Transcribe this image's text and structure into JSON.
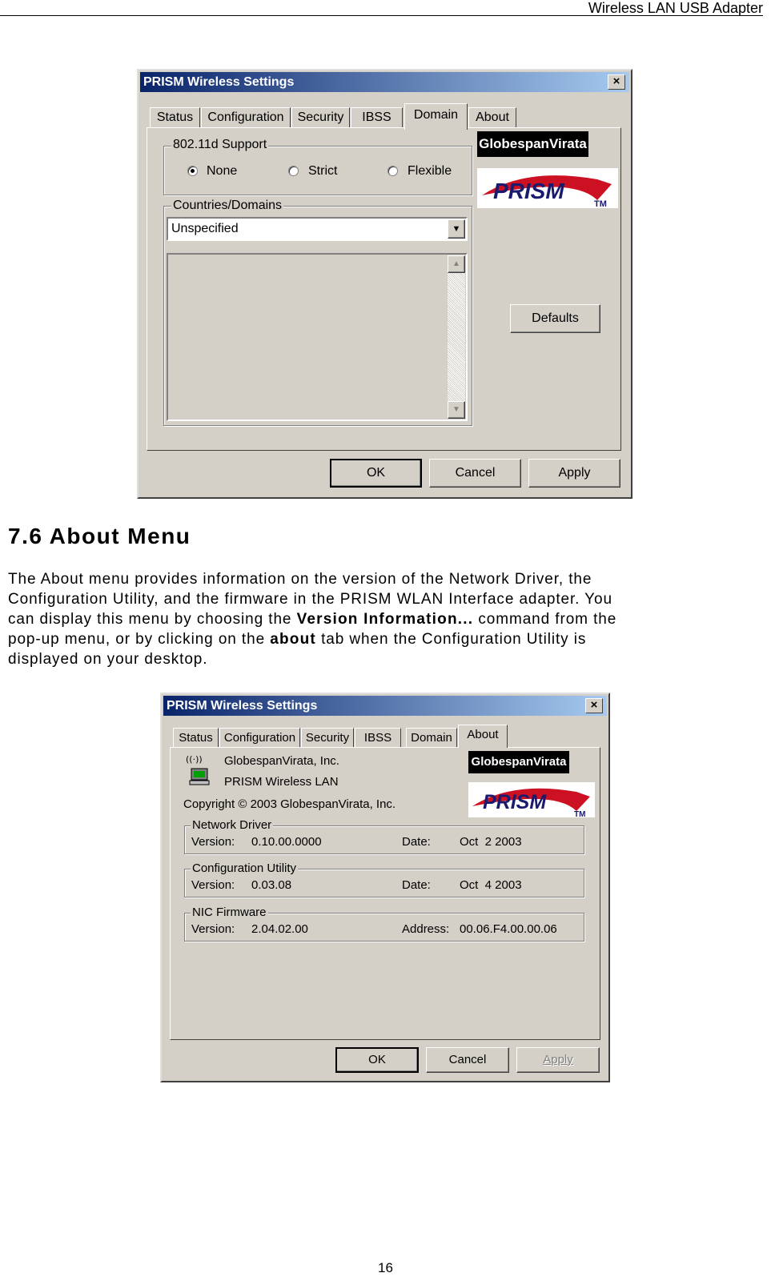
{
  "header": {
    "title": "Wireless LAN USB Adapter"
  },
  "page_number": "16",
  "section": {
    "heading": "7.6 About Menu",
    "para_1": "The About menu provides information on the version of the Network Driver, the",
    "para_2": "Configuration Utility, and the firmware in the PRISM WLAN Interface adapter. You",
    "para_3a": "can display this menu by choosing the ",
    "para_3b": "Version Information...",
    "para_3c": " command from the",
    "para_4a": "pop-up menu, or by clicking on the ",
    "para_4b": "about",
    "para_4c": " tab when the Configuration Utility is",
    "para_5": "displayed on your desktop."
  },
  "dialog1": {
    "title": "PRISM Wireless Settings",
    "close": "×",
    "tabs": [
      "Status",
      "Configuration",
      "Security",
      "IBSS",
      "Domain",
      "About"
    ],
    "active_tab": "Domain",
    "support_group": "802.11d Support",
    "radios": [
      "None",
      "Strict",
      "Flexible"
    ],
    "selected_radio": "None",
    "countries_group": "Countries/Domains",
    "dropdown_value": "Unspecified",
    "defaults_button": "Defaults",
    "logo_gv": "GlobespanVirata",
    "logo_prism": "PRISM",
    "logo_tm": "TM",
    "ok": "OK",
    "cancel": "Cancel",
    "apply": "Apply"
  },
  "dialog2": {
    "title": "PRISM Wireless Settings",
    "close": "×",
    "tabs": [
      "Status",
      "Configuration",
      "Security",
      "IBSS",
      "Domain",
      "About"
    ],
    "active_tab": "About",
    "company": "GlobespanVirata, Inc.",
    "product": "PRISM Wireless LAN",
    "copyright": "Copyright © 2003  GlobespanVirata, Inc.",
    "logo_gv": "GlobespanVirata",
    "logo_prism": "PRISM",
    "logo_tm": "TM",
    "network_driver": {
      "group": "Network Driver",
      "version_label": "Version:",
      "version": "0.10.00.0000",
      "date_label": "Date:",
      "date": "Oct  2 2003"
    },
    "config_utility": {
      "group": "Configuration Utility",
      "version_label": "Version:",
      "version": "0.03.08",
      "date_label": "Date:",
      "date": "Oct  4 2003"
    },
    "nic_firmware": {
      "group": "NIC Firmware",
      "version_label": "Version:",
      "version": "2.04.02.00",
      "address_label": "Address:",
      "address": "00.06.F4.00.00.06"
    },
    "ok": "OK",
    "cancel": "Cancel",
    "apply": "Apply"
  },
  "colors": {
    "title_bar_start": "#0a246a",
    "title_bar_end": "#a6caf0",
    "dialog_face": "#d4d0c8",
    "prism_red": "#cc1122",
    "prism_navy": "#1a1a6e"
  }
}
